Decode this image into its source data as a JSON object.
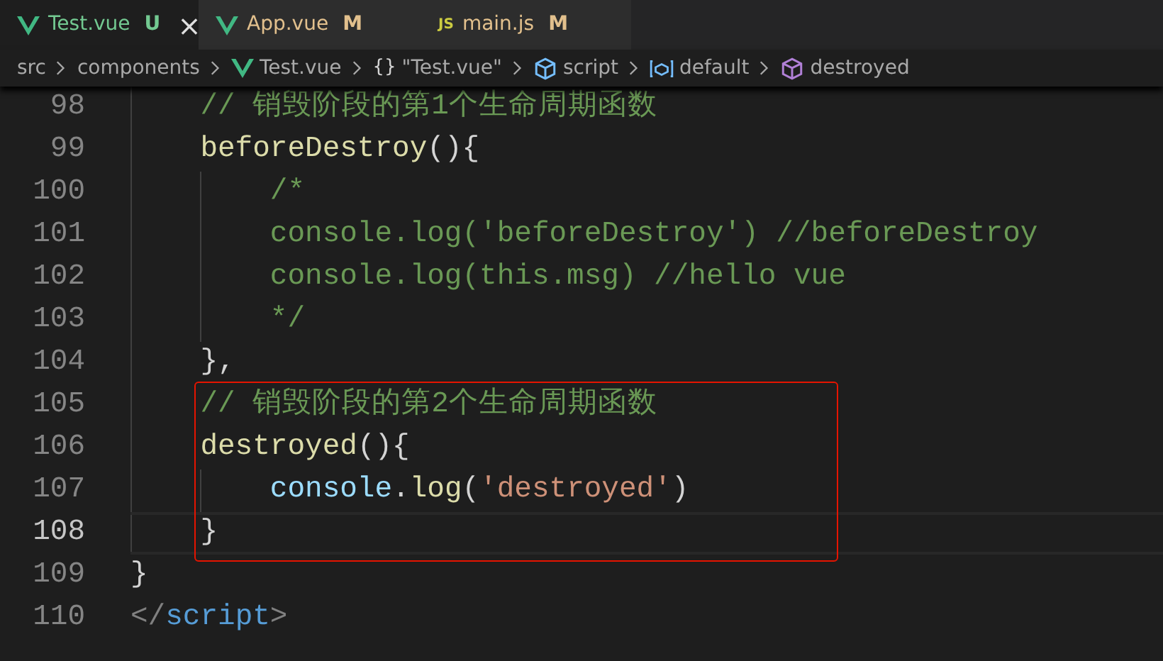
{
  "tabs": [
    {
      "label": "Test.vue",
      "kind": "vue",
      "status": "U",
      "selected": true,
      "close_glyph": "×"
    },
    {
      "label": "App.vue",
      "kind": "vue",
      "status": "M",
      "selected": false
    },
    {
      "label": "main.js",
      "kind": "js",
      "icon_label": "JS",
      "status": "M",
      "selected": false
    }
  ],
  "breadcrumb": [
    {
      "label": "src"
    },
    {
      "label": "components"
    },
    {
      "label": "Test.vue",
      "kind": "vue"
    },
    {
      "label": "\"Test.vue\"",
      "kind": "braces",
      "icon_label": "{}"
    },
    {
      "label": "script",
      "kind": "module"
    },
    {
      "label": "default",
      "kind": "variable"
    },
    {
      "label": "destroyed",
      "kind": "method"
    }
  ],
  "editor": {
    "sections": [
      {
        "highlighted": false,
        "lines": [
          {
            "number": "98",
            "current": false,
            "tokens": [
              {
                "kind": "comment",
                "text": "    // 销毁阶段的第1个生命周期函数"
              }
            ]
          },
          {
            "number": "99",
            "current": false,
            "tokens": [
              {
                "kind": "function",
                "text": "    beforeDestroy"
              },
              {
                "kind": "punct",
                "text": "(){"
              }
            ]
          },
          {
            "number": "100",
            "current": false,
            "tokens": [
              {
                "kind": "comment",
                "text": "        /*"
              }
            ]
          },
          {
            "number": "101",
            "current": false,
            "tokens": [
              {
                "kind": "comment",
                "text": "        console.log('beforeDestroy') //beforeDestroy"
              }
            ]
          },
          {
            "number": "102",
            "current": false,
            "tokens": [
              {
                "kind": "comment",
                "text": "        console.log(this.msg) //hello vue"
              }
            ]
          },
          {
            "number": "103",
            "current": false,
            "tokens": [
              {
                "kind": "comment",
                "text": "        */"
              }
            ]
          },
          {
            "number": "104",
            "current": false,
            "tokens": [
              {
                "kind": "punct",
                "text": "    },"
              }
            ]
          }
        ]
      },
      {
        "highlighted": true,
        "lines": [
          {
            "number": "105",
            "current": false,
            "tokens": [
              {
                "kind": "comment",
                "text": "    // 销毁阶段的第2个生命周期函数"
              }
            ]
          },
          {
            "number": "106",
            "current": false,
            "tokens": [
              {
                "kind": "function",
                "text": "    destroyed"
              },
              {
                "kind": "punct",
                "text": "(){"
              }
            ]
          },
          {
            "number": "107",
            "current": false,
            "tokens": [
              {
                "kind": "variable",
                "text": "        console"
              },
              {
                "kind": "punct",
                "text": "."
              },
              {
                "kind": "function",
                "text": "log"
              },
              {
                "kind": "punct",
                "text": "("
              },
              {
                "kind": "string",
                "text": "'destroyed'"
              },
              {
                "kind": "punct",
                "text": ")"
              }
            ]
          },
          {
            "number": "108",
            "current": true,
            "tokens": [
              {
                "kind": "punct",
                "text": "    }"
              }
            ]
          }
        ]
      },
      {
        "highlighted": false,
        "lines": [
          {
            "number": "109",
            "current": false,
            "tokens": [
              {
                "kind": "punct",
                "text": "}"
              }
            ]
          },
          {
            "number": "110",
            "current": false,
            "tokens": [
              {
                "kind": "tag-bracket",
                "text": "</"
              },
              {
                "kind": "tag",
                "text": "script"
              },
              {
                "kind": "tag-bracket",
                "text": ">"
              }
            ]
          }
        ]
      }
    ]
  }
}
